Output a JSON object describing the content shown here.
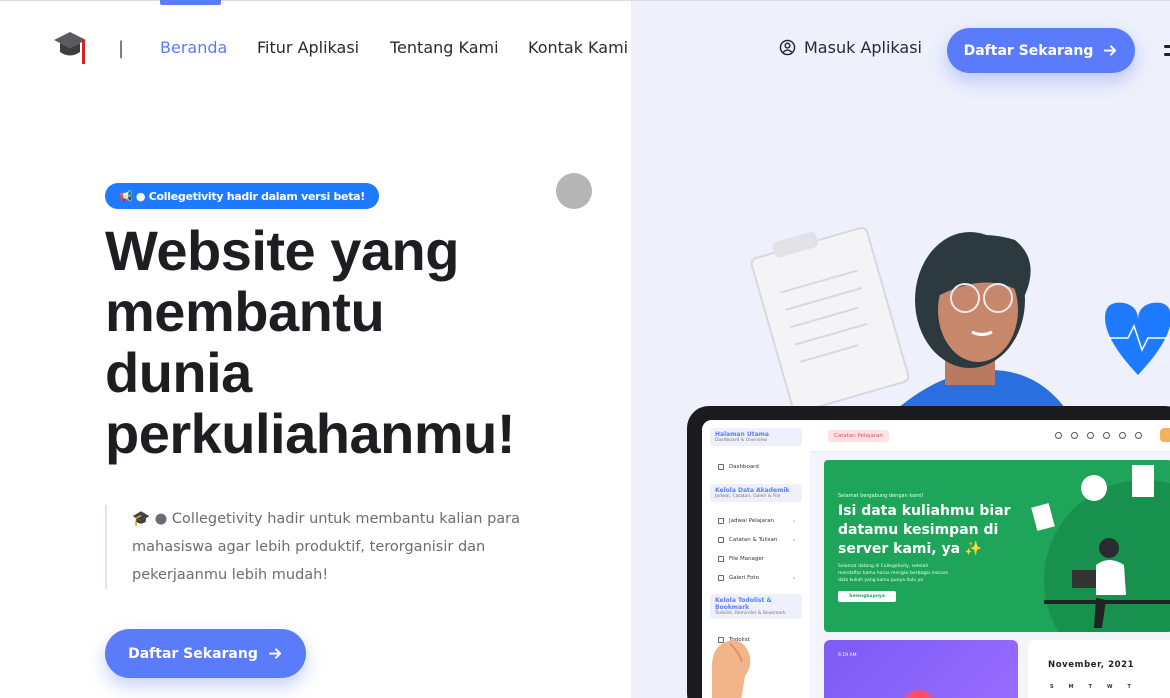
{
  "nav": {
    "separator": "|",
    "links": [
      "Beranda",
      "Fitur Aplikasi",
      "Tentang Kami",
      "Kontak Kami"
    ],
    "login_label": "Masuk Aplikasi",
    "cta_label": "Daftar Sekarang"
  },
  "hero": {
    "badge": "📢 ● Collegetivity hadir dalam versi beta!",
    "headline": [
      "Website yang",
      "membantu",
      "dunia",
      "perkuliahanmu!"
    ],
    "description": "🎓 ● Collegetivity hadir untuk membantu kalian para mahasiswa agar lebih produktif, terorganisir dan pekerjaanmu lebih mudah!",
    "cta_label": "Daftar Sekarang"
  },
  "app_preview": {
    "sidebar": {
      "main_card": {
        "title": "Halaman Utama",
        "subtitle": "Dashboard & Overview"
      },
      "dashboard": "Dashboard",
      "akademik_card": {
        "title": "Kelola Data Akademik",
        "subtitle": "Jadwal, Catatan, Galeri & File"
      },
      "akademik_items": [
        "Jadwal Pelajaran",
        "Catatan & Tulisan",
        "File Manager",
        "Galeri Foto"
      ],
      "todo_card": {
        "title": "Kelola Todolist & Bookmark",
        "subtitle": "Todolist, Reminder & Bookmark"
      },
      "todo_items": [
        "Todolist"
      ]
    },
    "top_pill": "Catatan Pelajaran",
    "welcome": {
      "small": "Selamat bergabung dengan kami!",
      "title": "Isi data kuliahmu biar datamu kesimpan di server kami, ya ✨",
      "desc": "Selamat datang di Collegetivity, setelah mendaftar kamu harus mengisi berbagai macam data kuliah yang kamu punya dulu ya",
      "button": "Selengkapnya"
    },
    "time_card": "6:19 AM",
    "calendar": {
      "month": "November, 2021",
      "days": [
        "S",
        "M",
        "T",
        "W",
        "T"
      ]
    }
  },
  "colors": {
    "primary": "#5b7cfa",
    "badge": "#1e7bff",
    "panel": "#eef0fb",
    "green": "#1ea55a"
  },
  "icons": [
    "graduation-cap-icon",
    "user-circle-icon",
    "arrow-right-icon",
    "menu-icon"
  ]
}
